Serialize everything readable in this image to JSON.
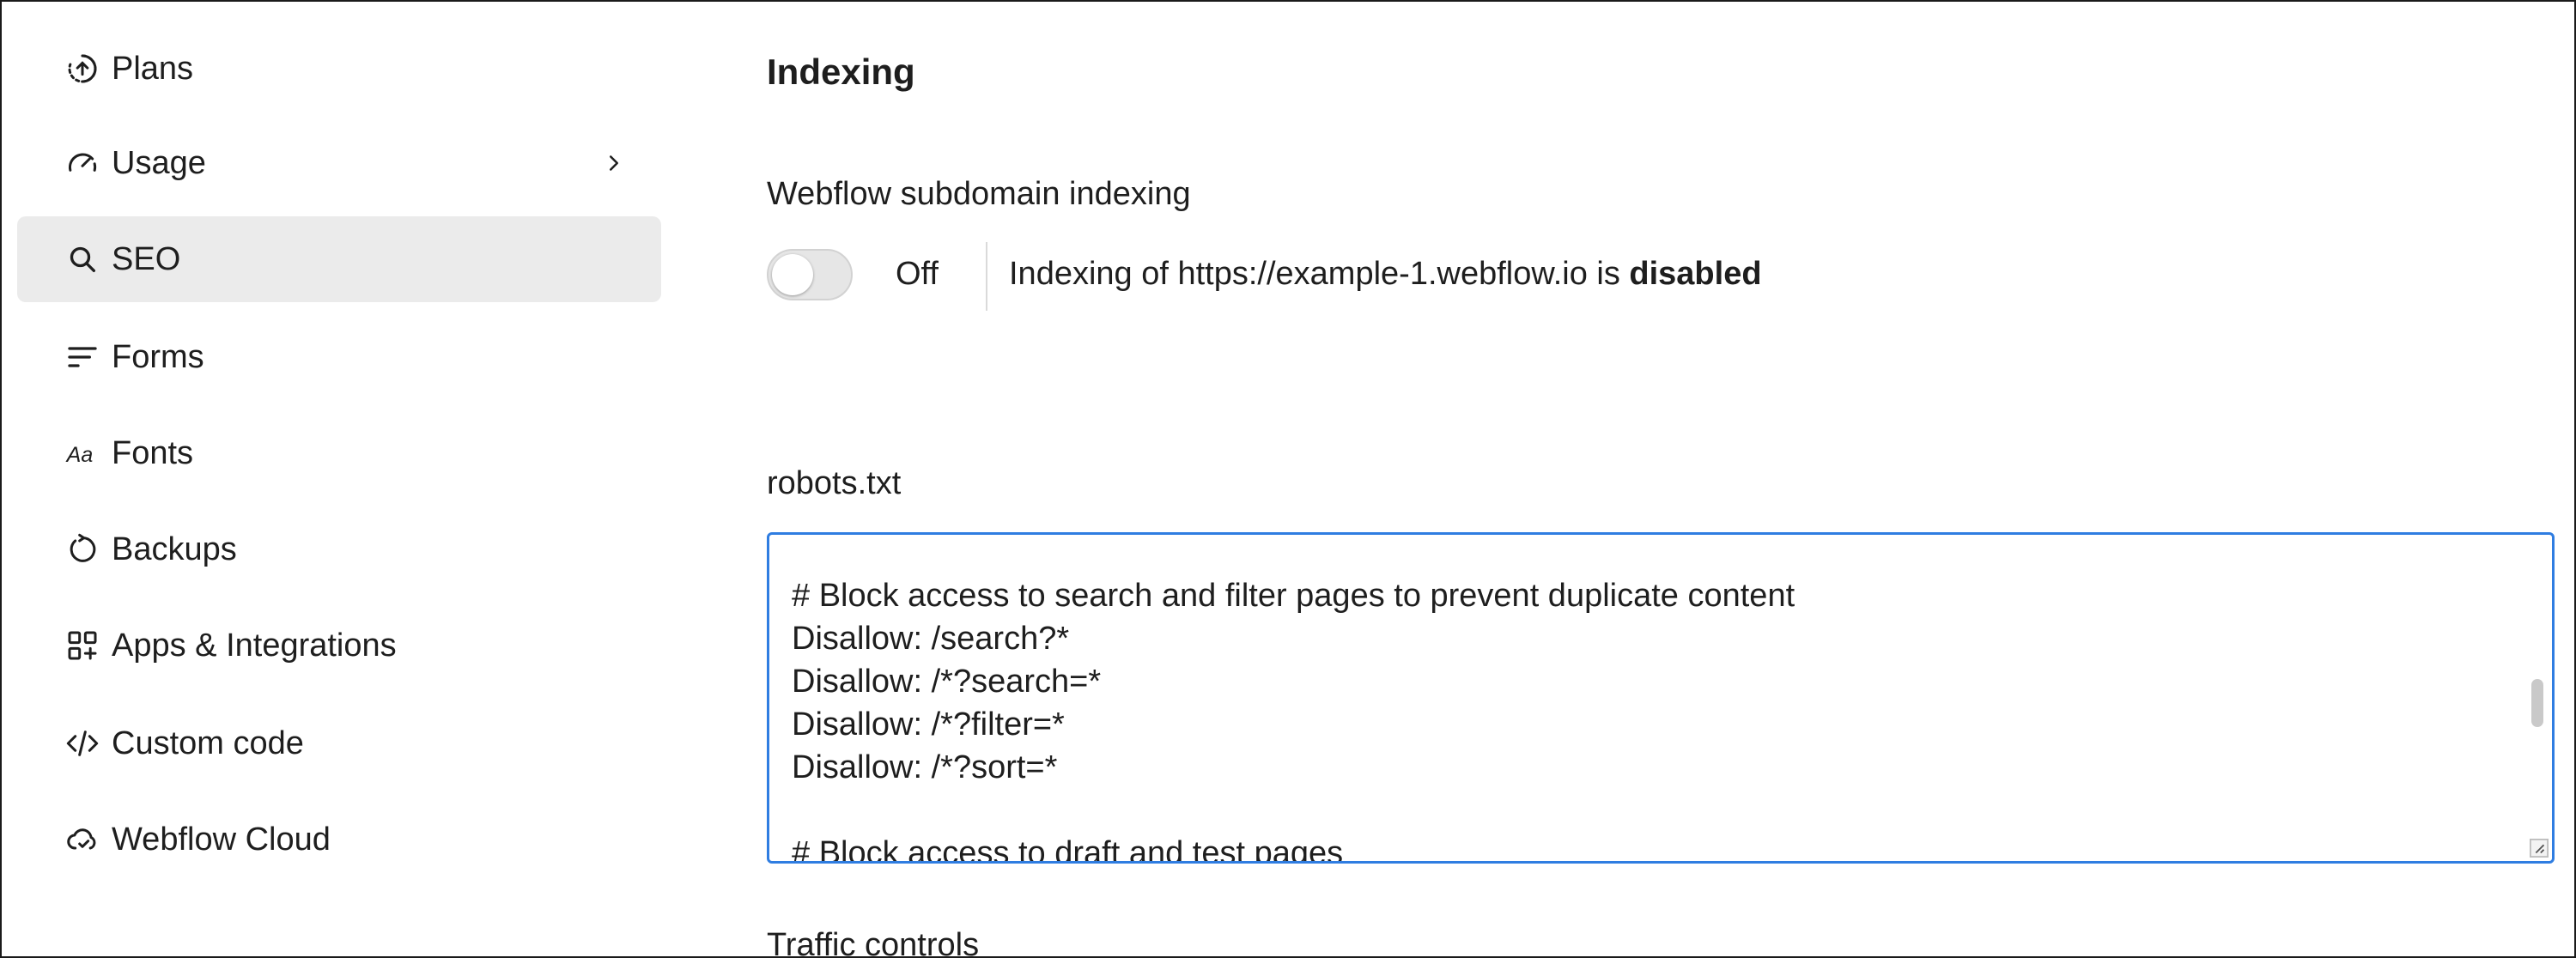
{
  "sidebar": {
    "items": [
      {
        "label": "Plans",
        "icon": "plans-icon"
      },
      {
        "label": "Usage",
        "icon": "gauge-icon"
      },
      {
        "label": "SEO",
        "icon": "search-icon"
      },
      {
        "label": "Forms",
        "icon": "forms-icon"
      },
      {
        "label": "Fonts",
        "icon": "fonts-icon"
      },
      {
        "label": "Backups",
        "icon": "backup-icon"
      },
      {
        "label": "Apps & Integrations",
        "icon": "apps-icon"
      },
      {
        "label": "Custom code",
        "icon": "code-icon"
      },
      {
        "label": "Webflow Cloud",
        "icon": "cloud-icon"
      }
    ],
    "active": "SEO"
  },
  "main": {
    "title": "Indexing",
    "subdomain": {
      "label": "Webflow subdomain indexing",
      "toggle_state": "Off",
      "status_prefix": "Indexing of https://example-1.webflow.io is ",
      "status_value": "disabled"
    },
    "robots": {
      "label": "robots.txt",
      "lines": [
        "# Block access to search and filter pages to prevent duplicate content",
        "Disallow: /search?*",
        "Disallow: /*?search=*",
        "Disallow: /*?filter=*",
        "Disallow: /*?sort=*",
        "",
        "# Block access to draft and test pages"
      ]
    },
    "next_section_label": "Traffic controls"
  },
  "colors": {
    "accent": "#2f7de1",
    "active_bg": "#ebebeb"
  }
}
